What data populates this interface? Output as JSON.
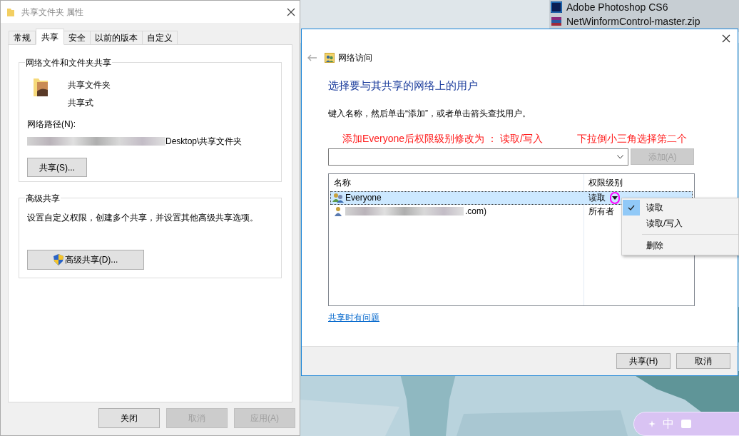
{
  "desktop": {
    "icons": [
      {
        "label": "Adobe Photoshop CS6",
        "kind": "ps"
      },
      {
        "label": "NetWinformControl-master.zip",
        "kind": "zip"
      }
    ],
    "ime_toolbar": {
      "label": "中"
    }
  },
  "properties_window": {
    "title": "共享文件夹 属性",
    "tabs": [
      {
        "label": "常规",
        "selected": false
      },
      {
        "label": "共享",
        "selected": true
      },
      {
        "label": "安全",
        "selected": false
      },
      {
        "label": "以前的版本",
        "selected": false
      },
      {
        "label": "自定义",
        "selected": false
      }
    ],
    "sharing_group": {
      "title": "网络文件和文件夹共享",
      "folder_name": "共享文件夹",
      "folder_state": "共享式",
      "path_label": "网络路径(N):",
      "path": "Desktop\\共享文件夹",
      "path_redacted": true,
      "button": "共享(S)..."
    },
    "advanced_group": {
      "title": "高级共享",
      "description": "设置自定义权限，创建多个共享，并设置其他高级共享选项。",
      "button": "高级共享(D)..."
    },
    "buttons": [
      {
        "label": "关闭",
        "disabled": false
      },
      {
        "label": "取消",
        "disabled": true
      },
      {
        "label": "应用(A)",
        "disabled": true
      }
    ]
  },
  "network_access_dialog": {
    "title": "网络访问",
    "heading": "选择要与其共享的网络上的用户",
    "instruction": "键入名称，然后单击“添加”，或者单击箭头查找用户。",
    "annotations": [
      "添加Everyone后权限级别修改为 ： 读取/写入",
      "下拉倒小三角选择第二个"
    ],
    "add_button": {
      "label": "添加(A)",
      "disabled": true
    },
    "table": {
      "columns": [
        "名称",
        "权限级别"
      ],
      "rows": [
        {
          "kind": "group",
          "name": "Everyone",
          "name_redacted": false,
          "permission": "读取",
          "selected": true
        },
        {
          "kind": "user",
          "name": ".com)",
          "name_redacted": true,
          "permission": "所有者",
          "selected": false
        }
      ]
    },
    "permission_menu": [
      {
        "kind": "option",
        "label": "读取",
        "checked": true
      },
      {
        "kind": "option",
        "label": "读取/写入",
        "checked": false
      },
      {
        "kind": "separator"
      },
      {
        "kind": "option",
        "label": "删除",
        "checked": false
      }
    ],
    "help_link": "共享时有问题",
    "buttons": [
      {
        "label": "共享(H)",
        "disabled": false
      },
      {
        "label": "取消",
        "disabled": false
      }
    ]
  }
}
